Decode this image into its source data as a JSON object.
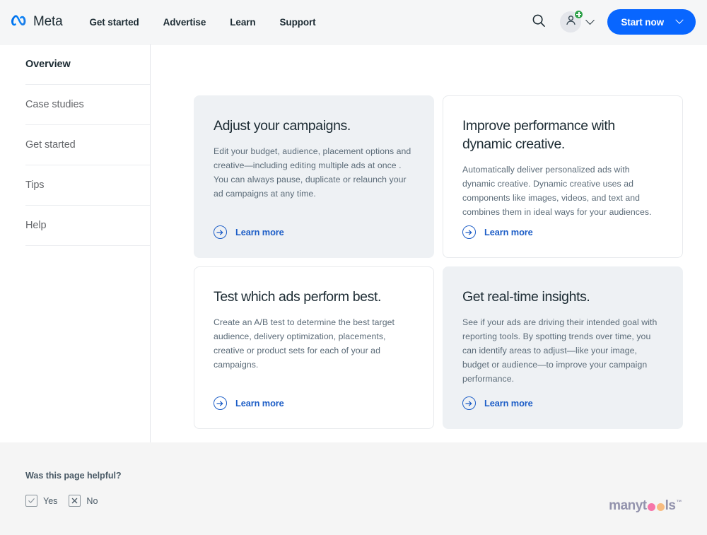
{
  "header": {
    "brand": {
      "name": "Meta",
      "logo_icon": "meta-infinity-logo"
    },
    "nav": [
      {
        "label": "Get started"
      },
      {
        "label": "Advertise"
      },
      {
        "label": "Learn"
      },
      {
        "label": "Support"
      }
    ],
    "search_icon": "search-icon",
    "account": {
      "avatar_icon": "person-icon",
      "badge_icon": "plus-badge-icon",
      "badge_color": "#31a24c",
      "chevron_icon": "chevron-down-icon"
    },
    "start_button": {
      "label": "Start now",
      "chevron_icon": "chevron-down-icon",
      "color": "#0866ff"
    }
  },
  "sidebar": {
    "items": [
      {
        "label": "Overview",
        "active": true
      },
      {
        "label": "Case studies",
        "active": false
      },
      {
        "label": "Get started",
        "active": false
      },
      {
        "label": "Tips",
        "active": false
      },
      {
        "label": "Help",
        "active": false
      }
    ]
  },
  "main": {
    "cards": [
      {
        "title": "Adjust your campaigns.",
        "body": "Edit your budget, audience, placement options and creative—including editing multiple ads at once . You can always pause, duplicate or relaunch your ad campaigns at any time.",
        "link_label": "Learn more",
        "link_icon": "arrow-right-circle-icon",
        "style": "filled"
      },
      {
        "title": "Improve performance with dynamic creative.",
        "body": "Automatically deliver personalized ads with dynamic creative. Dynamic creative uses ad components like images, videos, and text and combines them in ideal ways for your audiences.",
        "link_label": "Learn more",
        "link_icon": "arrow-right-circle-icon",
        "style": "plain"
      },
      {
        "title": "Test which ads perform best.",
        "body": "Create an A/B test to determine the best target audience, delivery optimization, placements, creative or product sets for each of your ad campaigns.",
        "link_label": "Learn more",
        "link_icon": "arrow-right-circle-icon",
        "style": "plain"
      },
      {
        "title": "Get real-time insights.",
        "body": "See if your ads are driving their intended goal with reporting tools. By spotting trends over time, you can identify areas to adjust—like your image, budget or audience—to improve your campaign performance.",
        "link_label": "Learn more",
        "link_icon": "arrow-right-circle-icon",
        "style": "filled"
      }
    ]
  },
  "footer": {
    "question": "Was this page helpful?",
    "options": [
      {
        "label": "Yes",
        "icon": "check-icon"
      },
      {
        "label": "No",
        "icon": "x-icon"
      }
    ],
    "watermark": {
      "part1": "manyt",
      "part2": "ls",
      "trademark": "™",
      "dot1_color": "#f76ca3",
      "dot2_color": "#f8b878"
    }
  }
}
